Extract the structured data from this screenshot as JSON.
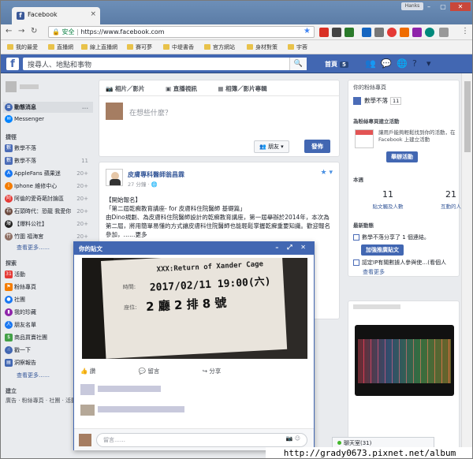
{
  "browser": {
    "tab_title": "Facebook",
    "user_chip": "Hanks",
    "url_secure": "安全",
    "url": "https://www.facebook.com",
    "bookmarks": [
      "我的最愛",
      "直播網",
      "線上直播網",
      "賽可夢",
      "中堤書香",
      "官方網站",
      "身材對策",
      "宇蓉"
    ]
  },
  "fb": {
    "search_placeholder": "搜尋人、地點和事物",
    "home_label": "首頁",
    "home_count": "5"
  },
  "left_nav": {
    "items": [
      {
        "label": "動態消息",
        "count": "..."
      },
      {
        "label": "Messenger",
        "count": ""
      }
    ],
    "shortcuts_title": "捷徑",
    "shortcuts": [
      {
        "label": "數學不落",
        "count": ""
      },
      {
        "label": "數學不落",
        "count": "11"
      },
      {
        "label": "AppleFans 蘋果迷",
        "count": "20+"
      },
      {
        "label": "Iphone 維修中心",
        "count": "20+"
      },
      {
        "label": "阿倫的愛奇葩討論區",
        "count": "20+"
      },
      {
        "label": "石頭時代：恐龍 我愛你",
        "count": "20+"
      },
      {
        "label": "【爆料公社】",
        "count": "20+"
      },
      {
        "label": "竹圍 福海宮",
        "count": "20+"
      }
    ],
    "shortcuts_more": "查看更多……",
    "explore_title": "探索",
    "explore": [
      {
        "label": "活動",
        "count": "20"
      },
      {
        "label": "粉絲專頁",
        "count": ""
      },
      {
        "label": "社團",
        "count": ""
      },
      {
        "label": "我的珍藏",
        "count": ""
      },
      {
        "label": "朋友名單",
        "count": ""
      },
      {
        "label": "商品買賣社團",
        "count": ""
      },
      {
        "label": "戳一下",
        "count": ""
      },
      {
        "label": "洞察報告",
        "count": ""
      }
    ],
    "explore_more": "查看更多……",
    "create_title": "建立",
    "create_links": "廣告 · 粉絲專頁 · 社團 · 活動"
  },
  "composer": {
    "tab_photo": "相片／影片",
    "tab_live": "直播視訊",
    "tab_album": "相簿／影片專輯",
    "placeholder": "在想些什麼？",
    "audience": "朋友",
    "post_button": "發佈"
  },
  "post": {
    "author": "皮膚專科醫師翁昌霖",
    "time": "27 分鐘 · 🌐",
    "text": "【開始報名】\n「第二屆乾癬教育講座- for 皮膚科住院醫師 基礎篇」\n由Dino規劃、為皮膚科住院醫師設計的乾癬教育講座，第一屆舉辦於2014年，本次為第二屆，將用簡單易懂的方式讓皮膚科住院醫師也能輕鬆掌握乾癬重要知識。歡迎報名參加，……更多"
  },
  "popup": {
    "title": "你的貼文",
    "ticket_title": "XXX:Return of Xander Cage",
    "ticket_time_label": "時間:",
    "ticket_time": "2017/02/11 19:00(六)",
    "ticket_seat_label": "座位:",
    "ticket_seat": "2 廳 2 排 8 號",
    "like": "讚",
    "comment": "留言",
    "share": "分享",
    "comment_placeholder": "留言……"
  },
  "right_col": {
    "pages_title": "你的粉絲專頁",
    "page_name": "數學不落",
    "page_count": "11",
    "create_event_title": "為粉絲專頁建立活動",
    "create_event_text": "讓用戶能夠輕鬆找到你的活動，在 Facebook 上建立活動",
    "create_event_button": "舉辦活動",
    "week_title": "本週",
    "stat1_value": "11",
    "stat1_label": "貼文觸及人數",
    "stat2_value": "21",
    "stat2_label": "互動的人",
    "recent_title": "最新動態",
    "recent1": "數學不落分享了 1 個連結。",
    "boost_button": "加強推廣貼文",
    "recent2": "認定IP有關數據人參與使…(看個人",
    "see_more": "查看更多"
  },
  "chat": {
    "label": "聊天室(31)"
  },
  "watermark": "http://grady0673.pixnet.net/album"
}
